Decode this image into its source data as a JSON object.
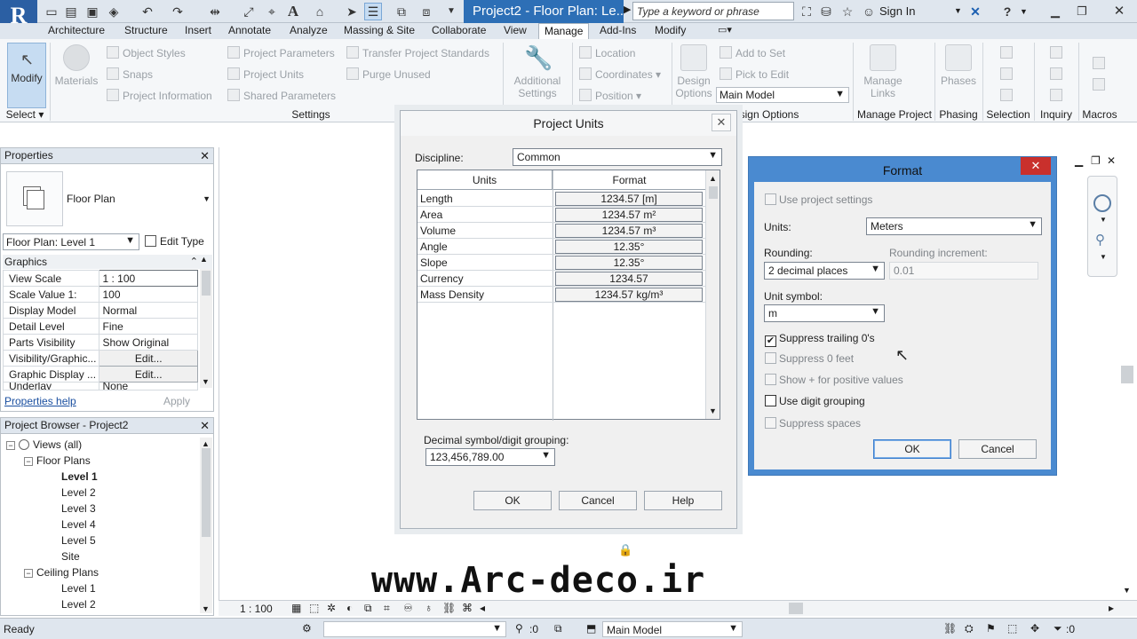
{
  "app": {
    "doc_title": "Project2 - Floor Plan: Le...",
    "search_placeholder": "Type a keyword or phrase",
    "sign_in": "Sign In"
  },
  "tabs": [
    "Architecture",
    "Structure",
    "Insert",
    "Annotate",
    "Analyze",
    "Massing & Site",
    "Collaborate",
    "View",
    "Manage",
    "Add-Ins",
    "Modify"
  ],
  "active_tab": "Manage",
  "ribbon": {
    "modify": "Modify",
    "select": "Select",
    "materials": "Materials",
    "object_styles": "Object  Styles",
    "snaps": "Snaps",
    "project_information": "Project  Information",
    "project_parameters": "Project  Parameters",
    "project_units": "Project  Units",
    "shared_parameters": "Shared  Parameters",
    "transfer_standards": "Transfer  Project  Standards",
    "purge_unused": "Purge  Unused",
    "additional_settings_1": "Additional",
    "additional_settings_2": "Settings",
    "location": "Location",
    "coordinates": "Coordinates",
    "position": "Position",
    "design_options_1": "Design",
    "design_options_2": "Options",
    "add_to_set": "Add to Set",
    "pick_to_edit": "Pick to Edit",
    "main_model": "Main Model",
    "manage_links_1": "Manage",
    "manage_links_2": "Links",
    "phases": "Phases",
    "panels": {
      "settings": "Settings",
      "design_options": "sign Options",
      "manage_project": "Manage Project",
      "phasing": "Phasing",
      "selection": "Selection",
      "inquiry": "Inquiry",
      "macros": "Macros"
    }
  },
  "properties": {
    "title": "Properties",
    "type_name": "Floor Plan",
    "instance": "Floor Plan: Level 1",
    "edit_type": "Edit Type",
    "group": "Graphics",
    "rows": [
      {
        "key": "View Scale",
        "value": "1 : 100"
      },
      {
        "key": "Scale Value    1:",
        "value": "100"
      },
      {
        "key": "Display Model",
        "value": "Normal"
      },
      {
        "key": "Detail Level",
        "value": "Fine"
      },
      {
        "key": "Parts Visibility",
        "value": "Show Original"
      },
      {
        "key": "Visibility/Graphic...",
        "value": "Edit..."
      },
      {
        "key": "Graphic Display ...",
        "value": "Edit..."
      },
      {
        "key": "Underlay",
        "value": "None"
      }
    ],
    "help": "Properties help",
    "apply": "Apply"
  },
  "browser": {
    "title": "Project Browser - Project2",
    "items": [
      {
        "label": "Views (all)",
        "level": 0,
        "toggle": "-"
      },
      {
        "label": "Floor Plans",
        "level": 1,
        "toggle": "-"
      },
      {
        "label": "Level 1",
        "level": 2,
        "bold": true
      },
      {
        "label": "Level 2",
        "level": 2
      },
      {
        "label": "Level 3",
        "level": 2
      },
      {
        "label": "Level 4",
        "level": 2
      },
      {
        "label": "Level 5",
        "level": 2
      },
      {
        "label": "Site",
        "level": 2
      },
      {
        "label": "Ceiling Plans",
        "level": 1,
        "toggle": "-"
      },
      {
        "label": "Level 1",
        "level": 2
      },
      {
        "label": "Level 2",
        "level": 2
      }
    ]
  },
  "project_units": {
    "title": "Project Units",
    "discipline_label": "Discipline:",
    "discipline_value": "Common",
    "col_units": "Units",
    "col_format": "Format",
    "rows": [
      {
        "unit": "Length",
        "format": "1234.57 [m]"
      },
      {
        "unit": "Area",
        "format": "1234.57 m²"
      },
      {
        "unit": "Volume",
        "format": "1234.57 m³"
      },
      {
        "unit": "Angle",
        "format": "12.35°"
      },
      {
        "unit": "Slope",
        "format": "12.35°"
      },
      {
        "unit": "Currency",
        "format": "1234.57"
      },
      {
        "unit": "Mass Density",
        "format": "1234.57 kg/m³"
      }
    ],
    "decimal_label": "Decimal symbol/digit grouping:",
    "decimal_value": "123,456,789.00",
    "ok": "OK",
    "cancel": "Cancel",
    "help": "Help"
  },
  "format": {
    "title": "Format",
    "use_project_settings": "Use project settings",
    "units_label": "Units:",
    "units_value": "Meters",
    "rounding_label": "Rounding:",
    "rounding_value": "2 decimal places",
    "rounding_increment_label": "Rounding increment:",
    "rounding_increment_value": "0.01",
    "unit_symbol_label": "Unit symbol:",
    "unit_symbol_value": "m",
    "suppress_trailing": "Suppress trailing 0's",
    "suppress_feet": "Suppress 0 feet",
    "show_plus": "Show + for positive values",
    "digit_grouping": "Use digit grouping",
    "suppress_spaces": "Suppress spaces",
    "ok": "OK",
    "cancel": "Cancel"
  },
  "viewbar": {
    "scale": "1 : 100"
  },
  "status": {
    "ready": "Ready",
    "count": ":0",
    "model": "Main Model"
  },
  "watermark": "www.Arc-deco.ir"
}
